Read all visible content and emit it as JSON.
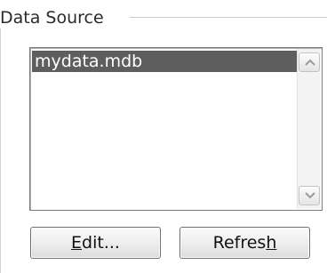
{
  "group": {
    "title": "Data Source"
  },
  "list": {
    "items": [
      {
        "label": "mydata.mdb",
        "selected": true
      }
    ]
  },
  "buttons": {
    "edit_label": "Edit...",
    "edit_mnemonic": "E",
    "refresh_label": "Refresh",
    "refresh_mnemonic": "h"
  },
  "colors": {
    "selection": "#5e5e5e",
    "selection_text": "#ffffff"
  },
  "icons": {
    "scroll_up": "chevron-up-icon",
    "scroll_down": "chevron-down-icon"
  }
}
